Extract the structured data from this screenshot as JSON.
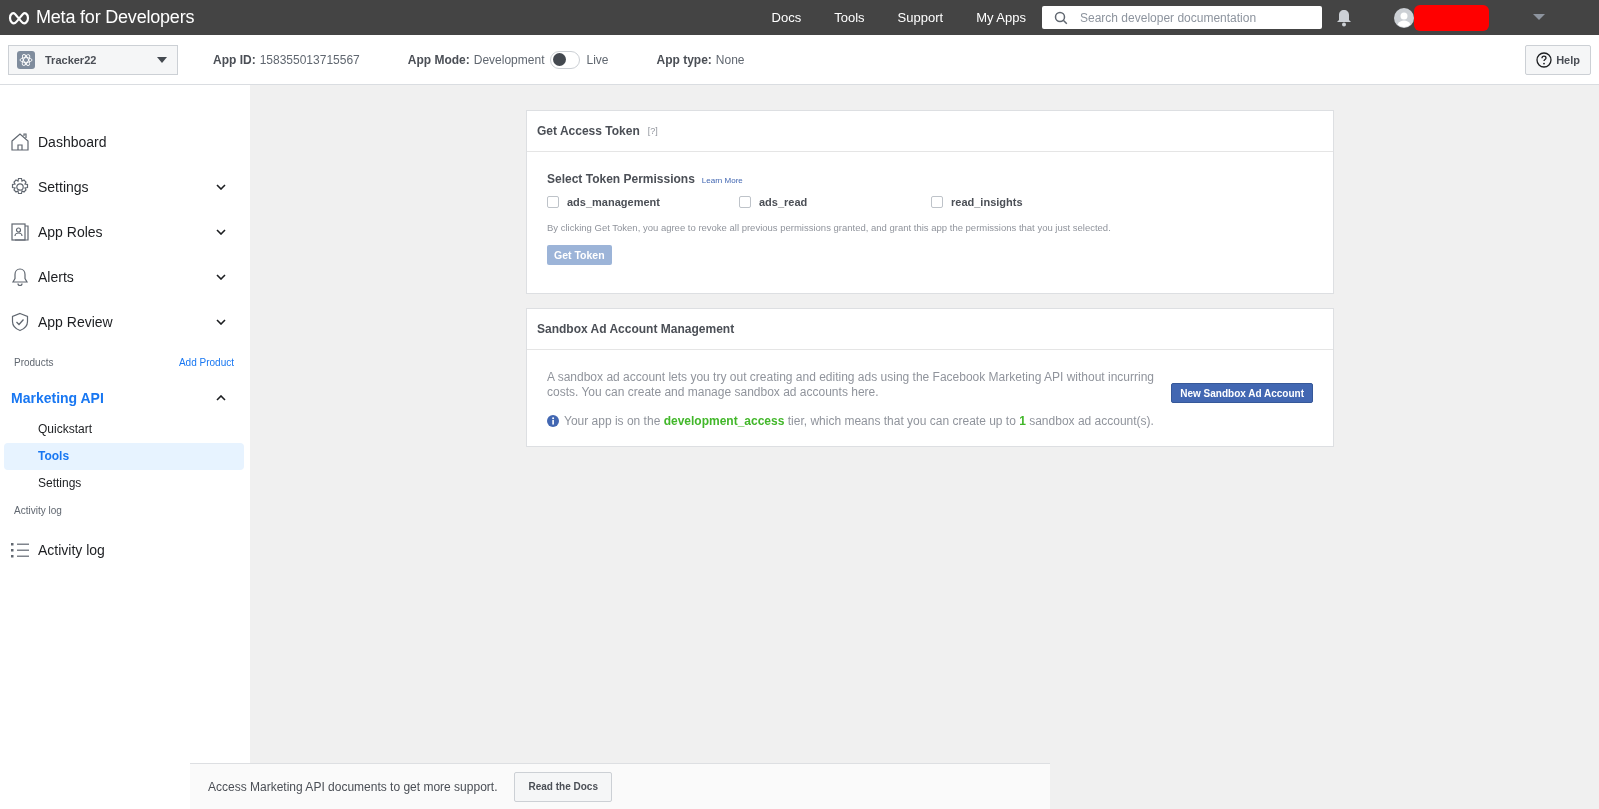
{
  "header": {
    "logo": "Meta for Developers",
    "nav": [
      "Docs",
      "Tools",
      "Support",
      "My Apps"
    ],
    "search": {
      "placeholder": "Search developer documentation"
    }
  },
  "app_bar": {
    "app_name": "Tracker22",
    "app_id_label": "App ID:",
    "app_id": "158355013715567",
    "mode_label": "App Mode:",
    "mode_off": "Development",
    "mode_on": "Live",
    "live": false,
    "type_label": "App type:",
    "type": "None",
    "help": "Help"
  },
  "sidebar": {
    "items": [
      {
        "label": "Dashboard"
      },
      {
        "label": "Settings",
        "expanded": false
      },
      {
        "label": "App Roles",
        "expanded": false
      },
      {
        "label": "Alerts",
        "expanded": false
      },
      {
        "label": "App Review",
        "expanded": false
      }
    ],
    "products_label": "Products",
    "add_product": "Add Product",
    "product": {
      "label": "Marketing API",
      "expanded": true,
      "children": [
        {
          "label": "Quickstart",
          "selected": false
        },
        {
          "label": "Tools",
          "selected": true
        },
        {
          "label": "Settings",
          "selected": false
        }
      ]
    },
    "activity_heading": "Activity log",
    "activity_item": "Activity log"
  },
  "token_card": {
    "title": "Get Access Token",
    "help_mark": "[?]",
    "section_title": "Select Token Permissions",
    "learn_more": "Learn More",
    "permissions": [
      {
        "label": "ads_management",
        "checked": false
      },
      {
        "label": "ads_read",
        "checked": false
      },
      {
        "label": "read_insights",
        "checked": false
      }
    ],
    "notice": "By clicking Get Token, you agree to revoke all previous permissions granted, and grant this app the permissions that you just selected.",
    "button": "Get Token",
    "button_disabled": true
  },
  "sandbox_card": {
    "title": "Sandbox Ad Account Management",
    "description": "A sandbox ad account lets you try out creating and editing ads using the Facebook Marketing API without incurring costs. You can create and manage sandbox ad accounts here.",
    "note": "Your app is on the **development_access** tier, which means that you can create up to **1** sandbox ad account(s).",
    "button": "New Sandbox Ad Account"
  },
  "footer": {
    "text": "Access Marketing API documents to get more support.",
    "button": "Read the Docs"
  }
}
